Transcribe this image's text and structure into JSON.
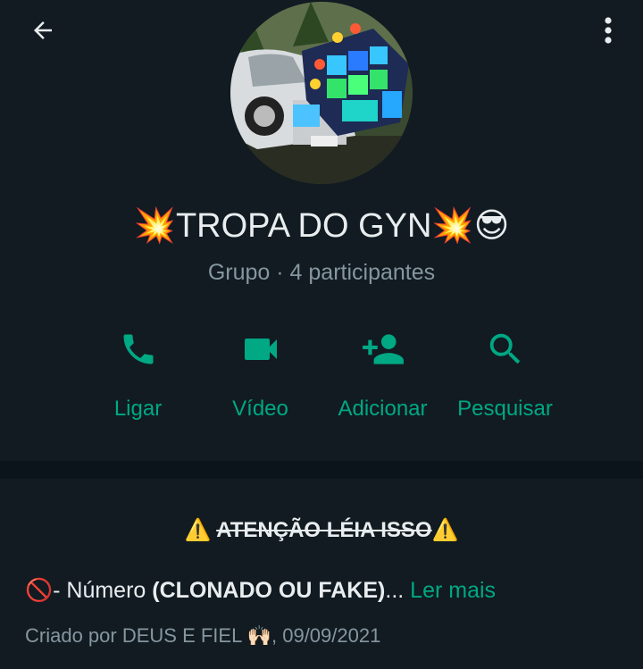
{
  "header": {
    "back_icon": "arrow-left-icon",
    "menu_icon": "more-vert-icon"
  },
  "group": {
    "title_prefix": "💥",
    "title": "TROPA DO GYN",
    "title_suffix": "💥😎",
    "subtitle": "Grupo · 4 participantes",
    "avatar": "group-photo-car-sound-system"
  },
  "actions": [
    {
      "label": "Ligar",
      "icon": "phone-icon"
    },
    {
      "label": "Vídeo",
      "icon": "videocam-icon"
    },
    {
      "label": "Adicionar",
      "icon": "person-add-icon"
    },
    {
      "label": "Pesquisar",
      "icon": "search-icon"
    }
  ],
  "description": {
    "warning_prefix": "⚠️",
    "warning_text": "ATENÇÃO LÉIA ISSO",
    "warning_suffix": "⚠️",
    "line_prefix": "🚫- Número ",
    "line_bold": "(CLONADO OU FAKE)",
    "line_ellipsis": "...",
    "read_more": "Ler mais",
    "created_by": "Criado por DEUS E FIEL 🙌🏻, 09/09/2021"
  },
  "colors": {
    "accent": "#00a884",
    "background": "#111b21",
    "divider": "#0b141a",
    "text_primary": "#e9edef",
    "text_secondary": "#8696a0"
  }
}
